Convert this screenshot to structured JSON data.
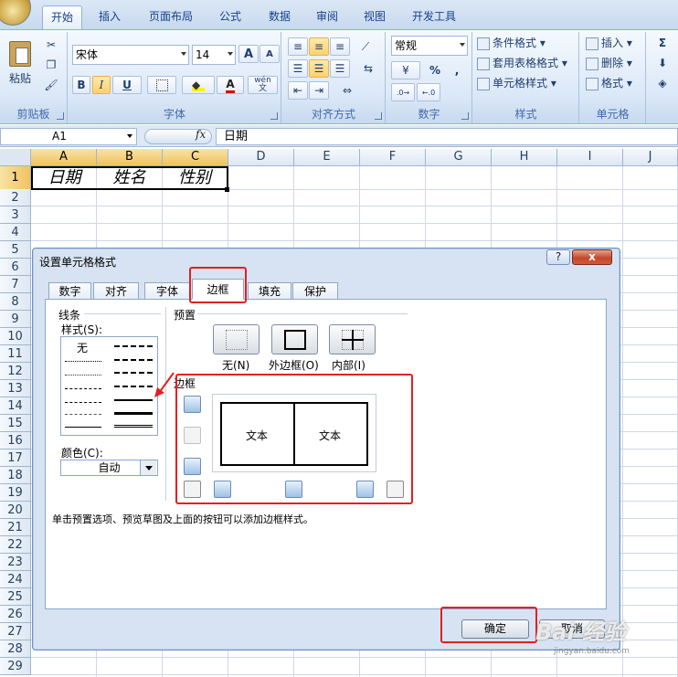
{
  "ribbon": {
    "tabs": [
      "开始",
      "插入",
      "页面布局",
      "公式",
      "数据",
      "审阅",
      "视图",
      "开发工具"
    ],
    "clipboard": {
      "paste": "粘贴",
      "group": "剪贴板"
    },
    "font": {
      "name": "宋体",
      "size": "14",
      "bold": "B",
      "italic": "I",
      "underline": "U",
      "wen": "wén\n文",
      "grow": "A",
      "shrink": "A",
      "group": "字体"
    },
    "alignment": {
      "group": "对齐方式"
    },
    "number": {
      "format": "常规",
      "percent": "%",
      "comma": ",",
      "group": "数字"
    },
    "styles": {
      "conditional": "条件格式",
      "table": "套用表格格式",
      "cell": "单元格样式",
      "group": "样式"
    },
    "cells": {
      "insert": "插入",
      "delete": "删除",
      "format": "格式",
      "group": "单元格"
    },
    "editing": {
      "sigma": "Σ"
    }
  },
  "formula_bar": {
    "name_box": "A1",
    "fx": "fx",
    "content": "日期"
  },
  "sheet": {
    "columns": [
      "A",
      "B",
      "C",
      "D",
      "E",
      "F",
      "G",
      "H",
      "I",
      "J"
    ],
    "rows": [
      "1",
      "2",
      "3",
      "4",
      "5",
      "6",
      "7",
      "8",
      "9",
      "10",
      "11",
      "12",
      "13",
      "14",
      "15",
      "16",
      "17",
      "18",
      "19",
      "20",
      "21",
      "22",
      "23",
      "24",
      "25",
      "26",
      "27",
      "28",
      "29"
    ],
    "row1": [
      "日期",
      "姓名",
      "性别"
    ]
  },
  "dialog": {
    "title": "设置单元格格式",
    "help": "?",
    "close": "x",
    "tabs": [
      "数字",
      "对齐",
      "字体",
      "边框",
      "填充",
      "保护"
    ],
    "line_section": "线条",
    "style_label": "样式(S):",
    "style_none": "无",
    "color_label": "颜色(C):",
    "color_value": "自动",
    "preset_section": "预置",
    "preset_none": "无(N)",
    "preset_outline": "外边框(O)",
    "preset_inside": "内部(I)",
    "border_section": "边框",
    "preview_text_left": "文本",
    "preview_text_right": "文本",
    "hint": "单击预置选项、预览草图及上面的按钮可以添加边框样式。",
    "ok": "确定",
    "cancel": "取消"
  },
  "watermark": {
    "main": "Bai 经验",
    "sub": "jingyan.baidu.com"
  },
  "colors": {
    "ribbon_bg": "#dbe8f7",
    "accent": "#15428b",
    "highlight_red": "#e02121",
    "selected_header": "#f1c15f"
  }
}
